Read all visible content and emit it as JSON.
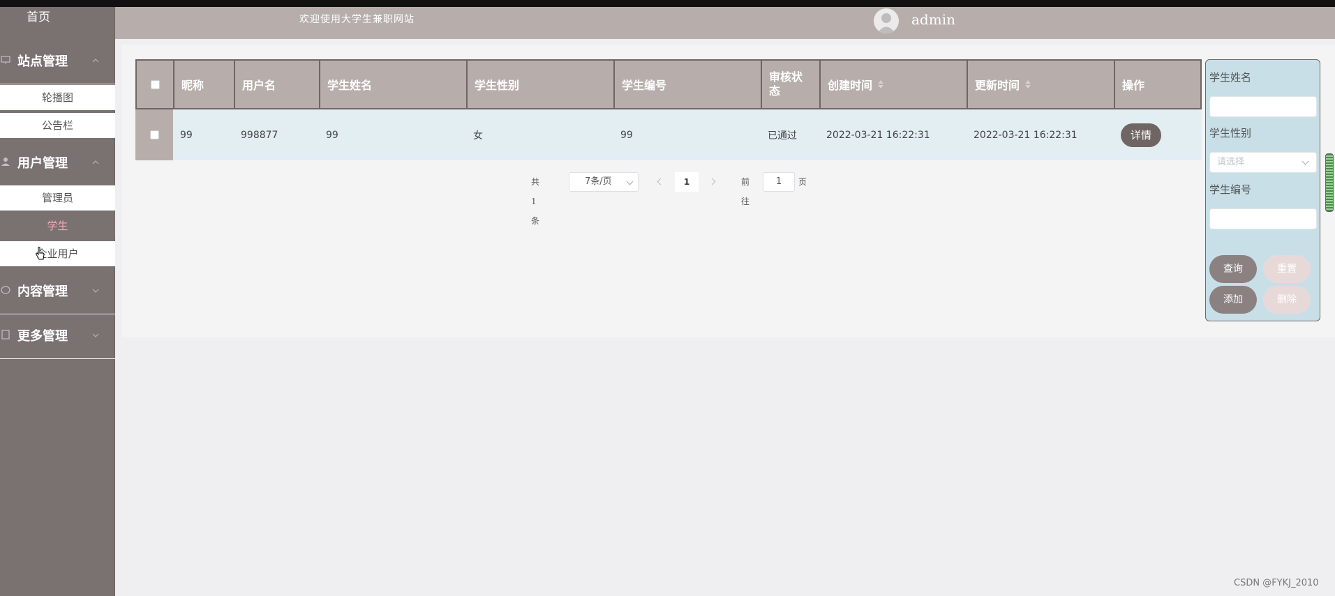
{
  "header": {
    "welcome": "欢迎使用大学生兼职网站",
    "user": "admin"
  },
  "sidebar": {
    "home": "首页",
    "groups": [
      {
        "label": "站点管理",
        "items": [
          "轮播图",
          "公告栏"
        ]
      },
      {
        "label": "用户管理",
        "items": [
          "管理员",
          "学生",
          "企业用户"
        ]
      },
      {
        "label": "内容管理",
        "items": []
      },
      {
        "label": "更多管理",
        "items": []
      }
    ],
    "active_item": "学生"
  },
  "table": {
    "columns": [
      "昵称",
      "用户名",
      "学生姓名",
      "学生性别",
      "学生编号",
      "审核状态",
      "创建时间",
      "更新时间",
      "操作"
    ],
    "rows": [
      {
        "nickname": "99",
        "username": "998877",
        "name": "99",
        "gender": "女",
        "number": "99",
        "status": "已通过",
        "created": "2022-03-21 16:22:31",
        "updated": "2022-03-21 16:22:31",
        "action": "详情"
      }
    ]
  },
  "pagination": {
    "total": "共 1 条",
    "page_size": "7条/页",
    "current_page": "1",
    "goto_label": "前往",
    "goto_value": "1",
    "page_suffix": "页"
  },
  "search_panel": {
    "name_label": "学生姓名",
    "gender_label": "学生性别",
    "gender_placeholder": "请选择",
    "number_label": "学生编号",
    "query": "查询",
    "reset": "重置",
    "add": "添加",
    "delete": "删除"
  },
  "watermark": "CSDN @FYKJ_2010"
}
